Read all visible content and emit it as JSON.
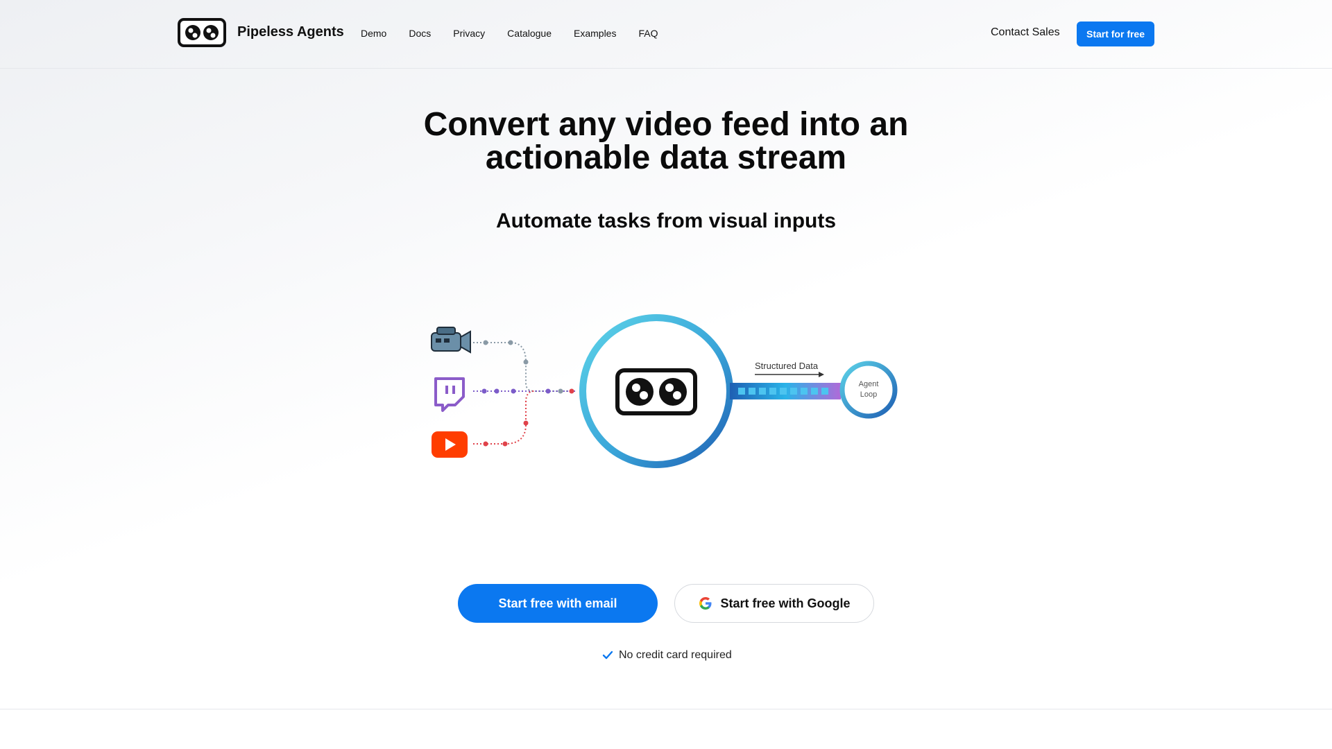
{
  "header": {
    "brand": "Pipeless Agents",
    "nav": [
      "Demo",
      "Docs",
      "Privacy",
      "Catalogue",
      "Examples",
      "FAQ"
    ],
    "contact": "Contact Sales",
    "cta": "Start for free"
  },
  "hero": {
    "title_line1": "Convert any video feed into an",
    "title_line2": "actionable data stream",
    "subtitle": "Automate tasks from visual inputs"
  },
  "diagram": {
    "label_structured": "Structured Data",
    "agent_line1": "Agent",
    "agent_line2": "Loop",
    "icons": [
      "video-camera-icon",
      "twitch-icon",
      "youtube-icon"
    ]
  },
  "cta": {
    "email": "Start free with email",
    "google": "Start free with Google",
    "note": "No credit card required"
  },
  "colors": {
    "accent": "#0b78f0",
    "twitch": "#8b5cc9",
    "youtube": "#ff3d00",
    "ring_light": "#5dd3e8",
    "ring_dark": "#1e5fb3"
  }
}
